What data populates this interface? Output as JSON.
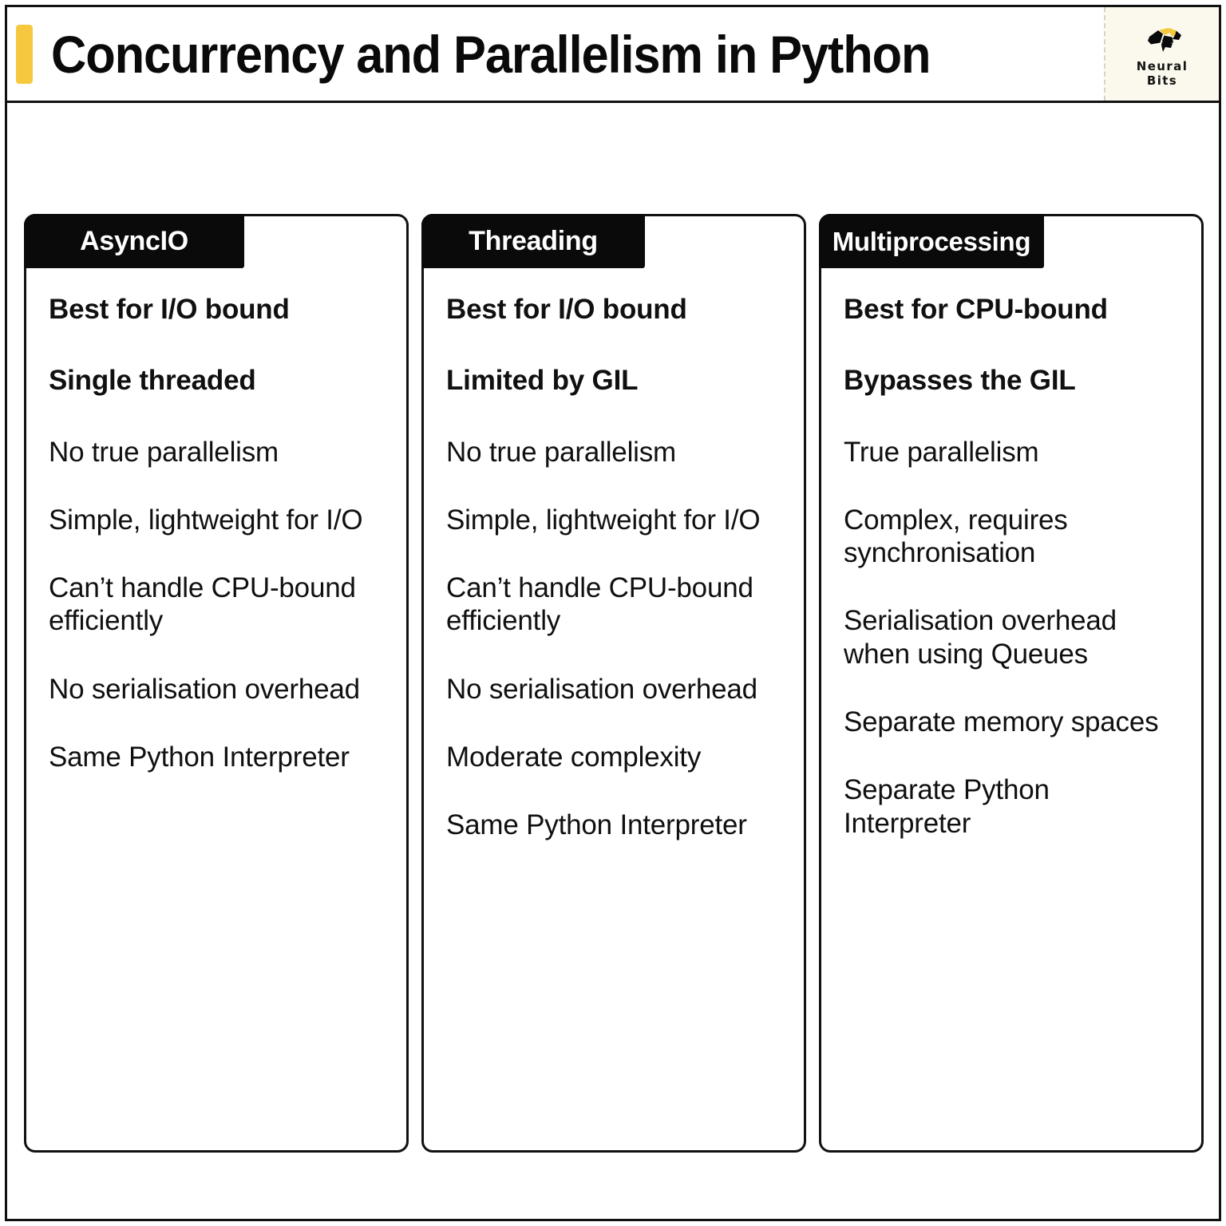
{
  "header": {
    "title": "Concurrency and Parallelism in Python",
    "accent_color": "#F6C83E",
    "logo": {
      "icon": "brain-logo-icon",
      "line1": "Neural",
      "line2": "Bits",
      "panel_color": "#FBF8ED",
      "mark_colors": [
        "#0a0a0a",
        "#F6C83E"
      ]
    }
  },
  "cards": [
    {
      "id": "asyncio",
      "title": "AsyncIO",
      "bullets": [
        {
          "text": "Best for I/O bound",
          "strong": true
        },
        {
          "text": "Single threaded",
          "strong": true
        },
        {
          "text": "No true parallelism",
          "strong": false
        },
        {
          "text": "Simple, lightweight for I/O",
          "strong": false
        },
        {
          "text": "Can’t handle CPU-bound efficiently",
          "strong": false
        },
        {
          "text": "No serialisation overhead",
          "strong": false
        },
        {
          "text": "Same Python Interpreter",
          "strong": false
        }
      ]
    },
    {
      "id": "threading",
      "title": "Threading",
      "bullets": [
        {
          "text": "Best for I/O bound",
          "strong": true
        },
        {
          "text": "Limited by GIL",
          "strong": true
        },
        {
          "text": "No true parallelism",
          "strong": false
        },
        {
          "text": "Simple, lightweight for I/O",
          "strong": false
        },
        {
          "text": "Can’t handle CPU-bound efficiently",
          "strong": false
        },
        {
          "text": "No serialisation overhead",
          "strong": false
        },
        {
          "text": "Moderate complexity",
          "strong": false
        },
        {
          "text": "Same Python Interpreter",
          "strong": false
        }
      ]
    },
    {
      "id": "multiprocessing",
      "title": "Multiprocessing",
      "bullets": [
        {
          "text": "Best for CPU-bound",
          "strong": true
        },
        {
          "text": "Bypasses the GIL",
          "strong": true
        },
        {
          "text": "True parallelism",
          "strong": false
        },
        {
          "text": "Complex, requires synchronisation",
          "strong": false
        },
        {
          "text": "Serialisation overhead when using Queues",
          "strong": false
        },
        {
          "text": "Separate memory spaces",
          "strong": false
        },
        {
          "text": "Separate Python Interpreter",
          "strong": false
        }
      ]
    }
  ]
}
